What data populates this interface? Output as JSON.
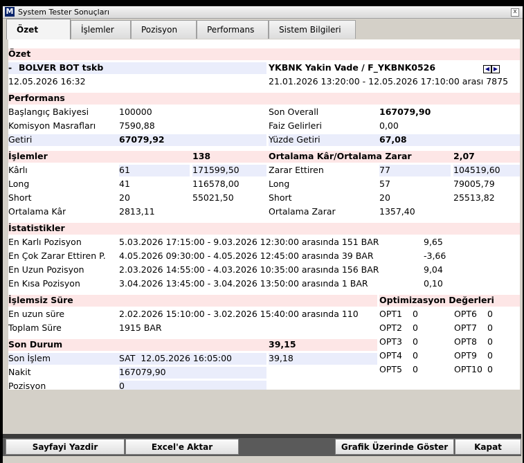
{
  "window": {
    "title": "System Tester Sonuçları",
    "icon_letter": "M",
    "close": "x"
  },
  "tabs": [
    "Özet",
    "İşlemler",
    "Pozisyon",
    "Performans",
    "Sistem Bilgileri"
  ],
  "ozet": {
    "section_title": "Özet",
    "dash": "-",
    "bot_name": "BOLVER BOT tskb",
    "bot_date": "12.05.2026 16:32",
    "symbol": "YKBNK Yakin Vade / F_YKBNK0526",
    "date_range": "21.01.2026 13:20:00 - 12.05.2026 17:10:00 arası 7875"
  },
  "performans": {
    "title": "Performans",
    "rows": [
      {
        "l1": "Başlangıç Bakiyesi",
        "v1": "100000",
        "l2": "Son Overall",
        "v2": "167079,90"
      },
      {
        "l1": "Komisyon Masrafları",
        "v1": "7590,88",
        "l2": "Faiz Gelirleri",
        "v2": "0,00"
      },
      {
        "l1": "Getiri",
        "v1": "67079,92",
        "l2": "Yüzde Getiri",
        "v2": "67,08"
      }
    ]
  },
  "islemler": {
    "title": "İşlemler",
    "count": "138",
    "right_title": "Ortalama Kâr/Ortalama Zarar",
    "ratio": "2,07",
    "rows": [
      {
        "l1": "Kârlı",
        "n1": "61",
        "a1": "171599,50",
        "l2": "Zarar Ettiren",
        "n2": "77",
        "a2": "104519,60"
      },
      {
        "l1": "Long",
        "n1": "41",
        "a1": "116578,00",
        "l2": "Long",
        "n2": "57",
        "a2": "79005,79"
      },
      {
        "l1": "Short",
        "n1": "20",
        "a1": "55021,50",
        "l2": "Short",
        "n2": "20",
        "a2": "25513,82"
      },
      {
        "l1": "Ortalama Kâr",
        "n1": "2813,11",
        "a1": "",
        "l2": "Ortalama Zarar",
        "n2": "1357,40",
        "a2": ""
      }
    ]
  },
  "istatistikler": {
    "title": "İstatistikler",
    "rows": [
      {
        "label": "En Karlı Pozisyon",
        "range": "5.03.2026 17:15:00 - 9.03.2026 12:30:00 arasında 151 BAR",
        "value": "9,65"
      },
      {
        "label": "En Çok Zarar Ettiren P.",
        "range": "4.05.2026 09:30:00 - 4.05.2026 12:45:00 arasında 39 BAR",
        "value": "-3,66"
      },
      {
        "label": "En Uzun Pozisyon",
        "range": "2.03.2026 14:55:00 - 4.03.2026 10:35:00 arasında 156 BAR",
        "value": "9,04"
      },
      {
        "label": "En Kısa Pozisyon",
        "range": "3.04.2026 13:45:00 - 3.04.2026 13:50:00 arasında 1 BAR",
        "value": "0,10"
      }
    ]
  },
  "islemsiz": {
    "title": "İşlemsiz Süre",
    "rows": [
      {
        "label": "En uzun süre",
        "value": "2.02.2026 15:10:00 - 3.02.2026 15:40:00 arasında 110"
      },
      {
        "label": "Toplam Süre",
        "value": "1915 BAR"
      }
    ]
  },
  "son_durum": {
    "title": "Son Durum",
    "title_value": "39,15",
    "rows": [
      {
        "label": "Son İşlem",
        "value": "SAT  12.05.2026 16:05:00",
        "extra": "39,18"
      },
      {
        "label": "Nakit",
        "value": "167079,90",
        "extra": ""
      },
      {
        "label": "Pozisyon",
        "value": "0",
        "extra": ""
      }
    ]
  },
  "optimizasyon": {
    "title": "Optimizasyon Değerleri",
    "left": [
      {
        "name": "OPT1",
        "value": "0"
      },
      {
        "name": "OPT2",
        "value": "0"
      },
      {
        "name": "OPT3",
        "value": "0"
      },
      {
        "name": "OPT4",
        "value": "0"
      },
      {
        "name": "OPT5",
        "value": "0"
      }
    ],
    "right": [
      {
        "name": "OPT6",
        "value": "0"
      },
      {
        "name": "OPT7",
        "value": "0"
      },
      {
        "name": "OPT8",
        "value": "0"
      },
      {
        "name": "OPT9",
        "value": "0"
      },
      {
        "name": "OPT10",
        "value": "0"
      }
    ]
  },
  "buttons": {
    "print": "Sayfayi Yazdir",
    "excel": "Excel'e Aktar",
    "chart": "Grafik Üzerinde Göster",
    "close": "Kapat"
  }
}
